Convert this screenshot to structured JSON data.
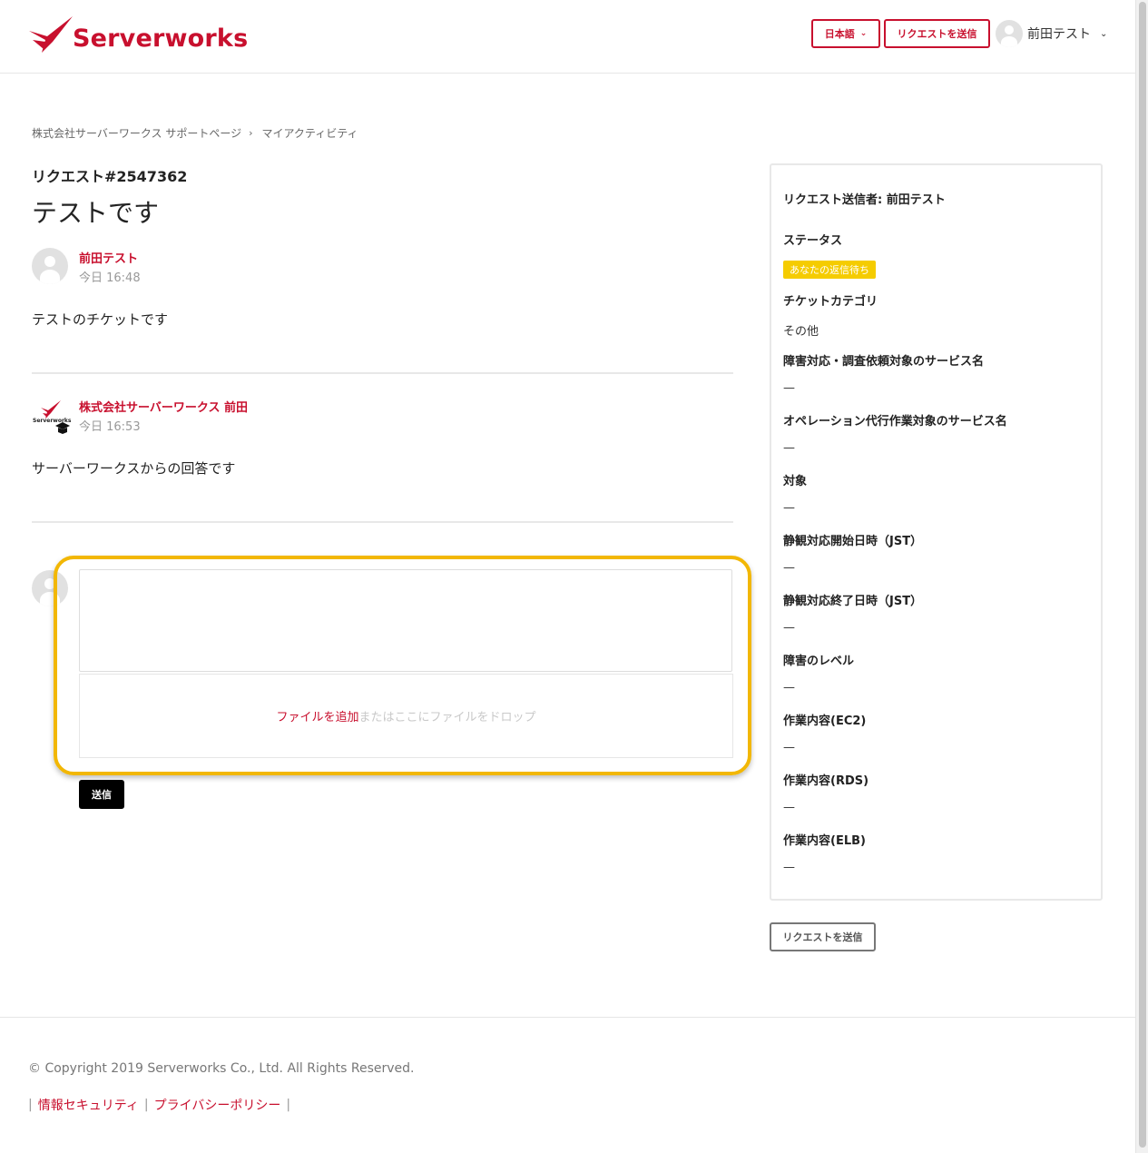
{
  "brand": {
    "name": "Serverworks",
    "color": "#c8102e"
  },
  "header": {
    "language_label": "日本語",
    "submit_request_label": "リクエストを送信",
    "user_name": "前田テスト"
  },
  "breadcrumb": [
    "株式会社サーバーワークス サポートページ",
    "マイアクティビティ"
  ],
  "request": {
    "id_label": "リクエスト#2547362",
    "title": "テストです"
  },
  "comments": [
    {
      "author": "前田テスト",
      "time": "今日 16:48",
      "body": "テストのチケットです"
    },
    {
      "author": "株式会社サーバーワークス 前田",
      "time": "今日 16:53",
      "body": "サーバーワークスからの回答です",
      "logo_text": "Serverworks"
    }
  ],
  "reply": {
    "add_file_label": "ファイルを追加",
    "drop_hint": "またはここにファイルをドロップ",
    "submit_label": "送信",
    "textarea_value": ""
  },
  "sidebar": {
    "sender_label": "リクエスト送信者: 前田テスト",
    "status_label": "ステータス",
    "status_value": "あなたの返信待ち",
    "status_color": "#f5cc00",
    "fields": [
      {
        "label": "チケットカテゴリ",
        "value": "その他"
      },
      {
        "label": "障害対応・調査依頼対象のサービス名",
        "value": "—"
      },
      {
        "label": "オペレーション代行作業対象のサービス名",
        "value": "—"
      },
      {
        "label": "対象",
        "value": "—"
      },
      {
        "label": "静観対応開始日時（JST）",
        "value": "—"
      },
      {
        "label": "静観対応終了日時（JST）",
        "value": "—"
      },
      {
        "label": "障害のレベル",
        "value": "—"
      },
      {
        "label": "作業内容(EC2)",
        "value": "—"
      },
      {
        "label": "作業内容(RDS)",
        "value": "—"
      },
      {
        "label": "作業内容(ELB)",
        "value": "—"
      }
    ],
    "submit_label": "リクエストを送信"
  },
  "footer": {
    "copyright": "© Copyright 2019 Serverworks Co., Ltd. All Rights Reserved.",
    "links": [
      "情報セキュリティ",
      "プライバシーポリシー"
    ]
  },
  "highlight_color": "#f2b705"
}
